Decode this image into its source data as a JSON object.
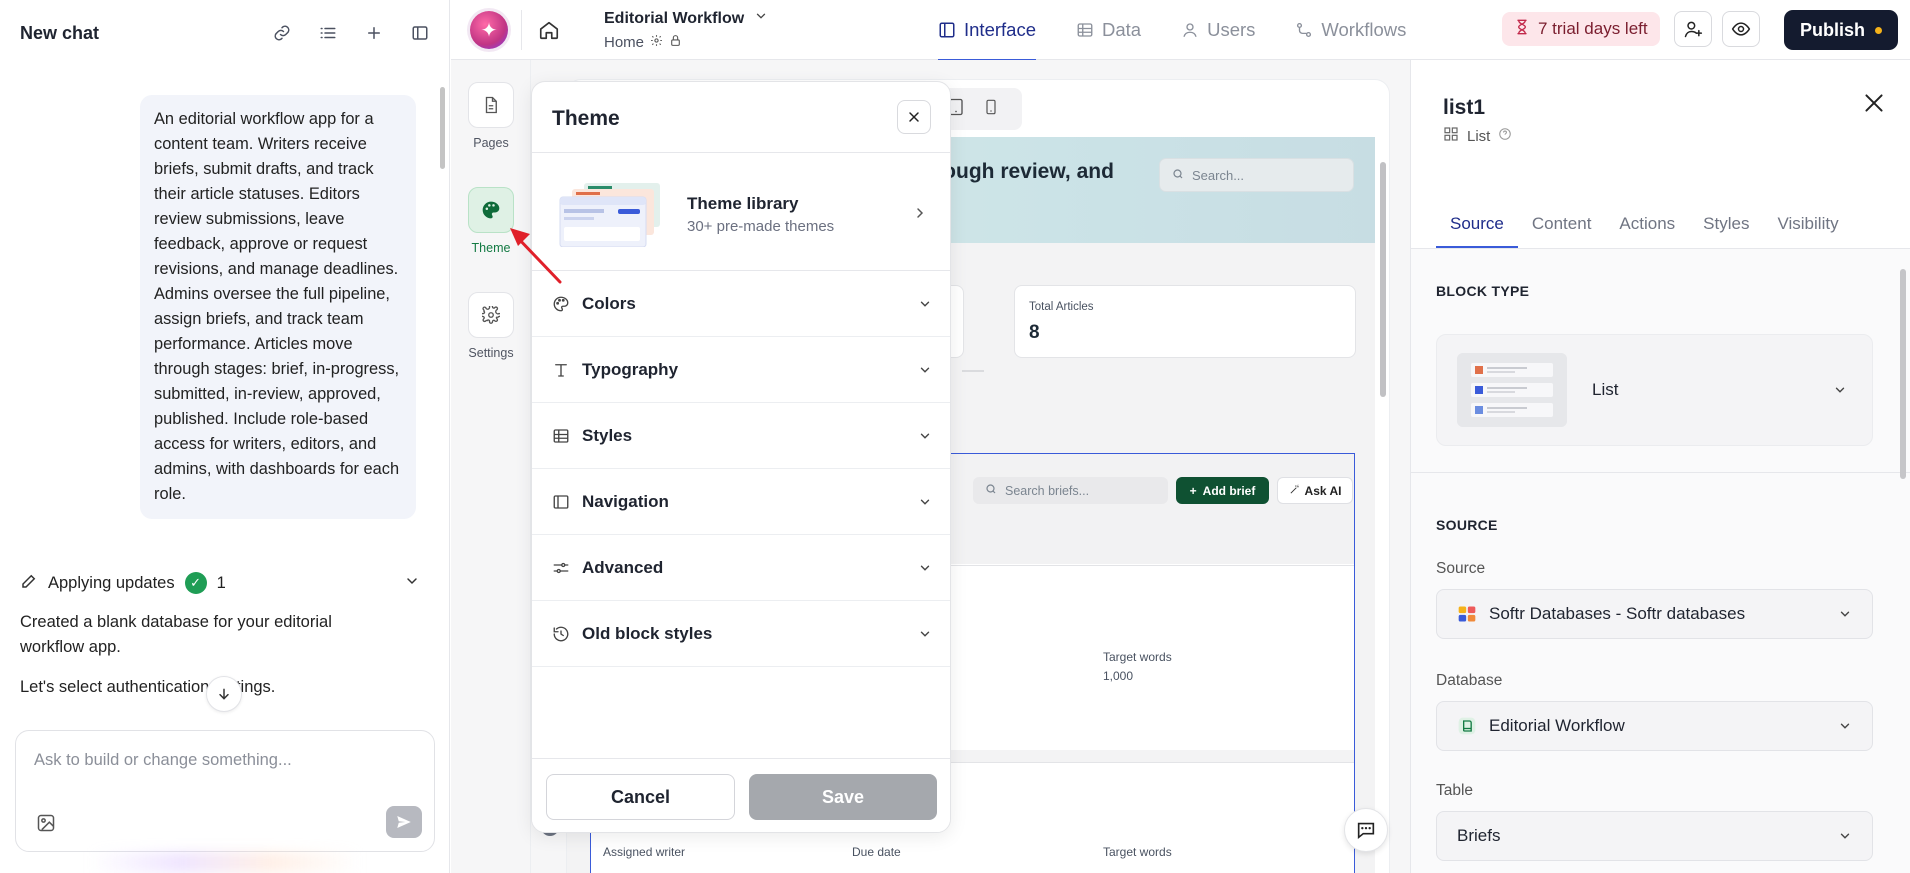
{
  "chat": {
    "title": "New chat",
    "user_message": "An editorial workflow app for a content team. Writers receive briefs, submit drafts, and track their article statuses. Editors review submissions, leave feedback, approve or request revisions, and manage deadlines. Admins oversee the full pipeline, assign briefs, and track team performance. Articles move through stages: brief, in-progress, submitted, in-review, approved, published. Include role-based access for writers, editors, and admins, with dashboards for each role.",
    "applying_label": "Applying updates",
    "applying_count": "1",
    "info_line1": "Created a blank database for your editorial workflow app.",
    "info_line2": "Let's select authentication settings.",
    "prompt_placeholder": "Ask to build or change something..."
  },
  "topbar": {
    "app_name": "Editorial Workflow",
    "page_name": "Home",
    "tabs": [
      {
        "label": "Interface",
        "icon": "layout-icon",
        "active": true
      },
      {
        "label": "Data",
        "icon": "table-icon",
        "active": false
      },
      {
        "label": "Users",
        "icon": "user-icon",
        "active": false
      },
      {
        "label": "Workflows",
        "icon": "workflow-icon",
        "active": false
      }
    ],
    "trial_label": "7 trial days left",
    "publish_label": "Publish"
  },
  "rail": {
    "pages_label": "Pages",
    "theme_label": "Theme",
    "settings_label": "Settings"
  },
  "canvas": {
    "hero_title": "rough review, and",
    "hero_search_placeholder": "Search...",
    "stat_label": "Total Articles",
    "stat_value": "8",
    "briefs_search_placeholder": "Search briefs...",
    "add_brief_label": "Add brief",
    "ask_ai_label": "Ask AI",
    "target_words_label": "Target words",
    "target_words_value": "1,000",
    "assigned_writer_label": "Assigned writer",
    "due_date_label": "Due date",
    "target_words_label2": "Target words"
  },
  "theme_panel": {
    "title": "Theme",
    "library_title": "Theme library",
    "library_sub": "30+ pre-made themes",
    "sections": [
      {
        "label": "Colors",
        "icon": "palette-icon"
      },
      {
        "label": "Typography",
        "icon": "type-icon"
      },
      {
        "label": "Styles",
        "icon": "grid-icon"
      },
      {
        "label": "Navigation",
        "icon": "sidebar-icon"
      },
      {
        "label": "Advanced",
        "icon": "sliders-icon"
      },
      {
        "label": "Old block styles",
        "icon": "history-icon"
      }
    ],
    "cancel_label": "Cancel",
    "save_label": "Save"
  },
  "right_panel": {
    "block_name": "list1",
    "block_kind": "List",
    "tabs": [
      "Source",
      "Content",
      "Actions",
      "Styles",
      "Visibility"
    ],
    "active_tab": "Source",
    "block_type_title": "BLOCK TYPE",
    "block_type_value": "List",
    "source_title": "SOURCE",
    "source_label": "Source",
    "source_value": "Softr Databases - Softr databases",
    "database_label": "Database",
    "database_value": "Editorial Workflow",
    "table_label": "Table",
    "table_value": "Briefs"
  },
  "colors": {
    "accent": "#3a5bd9",
    "publish_bg": "#141b2f",
    "brand_green": "#0f5132",
    "trial_bg": "#fde6ea",
    "arrow_red": "#e0202a"
  }
}
